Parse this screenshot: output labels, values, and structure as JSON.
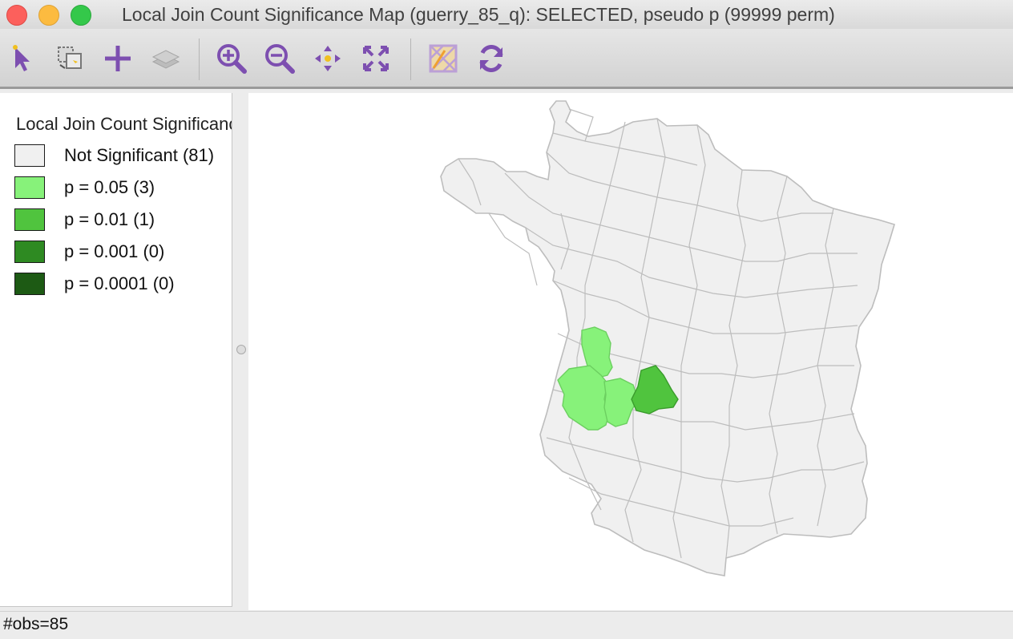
{
  "window": {
    "title": "Local Join Count Significance Map (guerry_85_q): SELECTED, pseudo p (99999 perm)"
  },
  "toolbar": {
    "tools": [
      {
        "name": "select-pointer-icon"
      },
      {
        "name": "selection-shape-icon"
      },
      {
        "name": "add-icon"
      },
      {
        "name": "layers-icon"
      },
      {
        "name": "zoom-in-icon"
      },
      {
        "name": "zoom-out-icon"
      },
      {
        "name": "pan-icon"
      },
      {
        "name": "full-extent-icon"
      },
      {
        "name": "basemap-icon"
      },
      {
        "name": "refresh-icon"
      }
    ],
    "accent_color": "#7d4fb0"
  },
  "legend": {
    "title": "Local Join Count Significance",
    "items": [
      {
        "label": "Not Significant (81)",
        "color": "#f0f0f0"
      },
      {
        "label": "p = 0.05 (3)",
        "color": "#87f27a"
      },
      {
        "label": "p = 0.01 (1)",
        "color": "#50c43e"
      },
      {
        "label": "p = 0.001 (0)",
        "color": "#2e8a22"
      },
      {
        "label": "p = 0.0001 (0)",
        "color": "#1d5a14"
      }
    ]
  },
  "map": {
    "not_significant_color": "#f0f0f0",
    "border_color": "#bdbdbd",
    "p05_color": "#87f27a",
    "p01_color": "#50c43e"
  },
  "status": {
    "text": "#obs=85"
  }
}
